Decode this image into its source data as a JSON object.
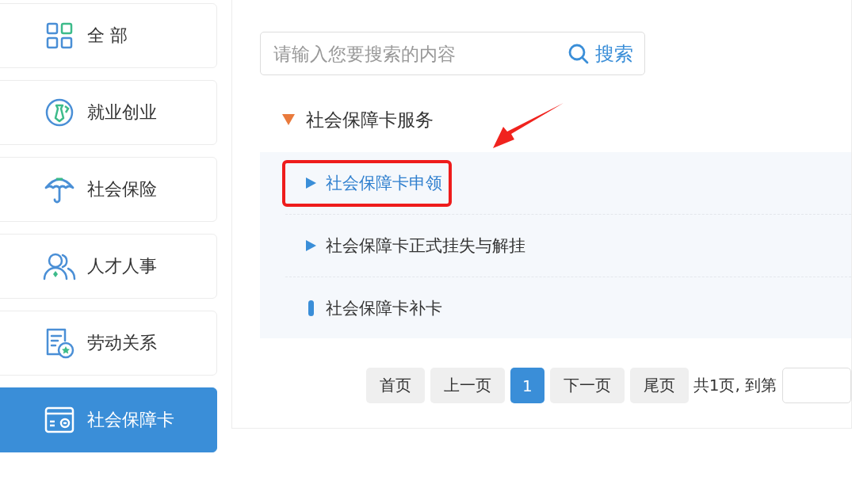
{
  "sidebar": {
    "items": [
      {
        "label": "全 部",
        "kind": "grid",
        "selected": false
      },
      {
        "label": "就业创业",
        "kind": "tie",
        "selected": false
      },
      {
        "label": "社会保险",
        "kind": "umbrella",
        "selected": false
      },
      {
        "label": "人才人事",
        "kind": "people",
        "selected": false
      },
      {
        "label": "劳动关系",
        "kind": "document",
        "selected": false
      },
      {
        "label": "社会保障卡",
        "kind": "card",
        "selected": true
      }
    ]
  },
  "search": {
    "placeholder": "请输入您要搜索的内容",
    "button": "搜索"
  },
  "tree": {
    "label": "社会保障卡服务",
    "expanded": true,
    "children": [
      {
        "label": "社会保障卡申领",
        "kind": "branch",
        "selected": true,
        "highlighted": true
      },
      {
        "label": "社会保障卡正式挂失与解挂",
        "kind": "branch",
        "selected": false,
        "highlighted": false
      },
      {
        "label": "社会保障卡补卡",
        "kind": "leaf",
        "selected": false,
        "highlighted": false
      }
    ]
  },
  "annotations": [
    {
      "kind": "arrow"
    }
  ],
  "pagination": {
    "buttons": [
      {
        "label": "首页",
        "kind": "nav",
        "selected": false
      },
      {
        "label": "上一页",
        "kind": "nav",
        "selected": false
      },
      {
        "label": "1",
        "kind": "page",
        "selected": true
      },
      {
        "label": "下一页",
        "kind": "nav",
        "selected": false
      },
      {
        "label": "尾页",
        "kind": "nav",
        "selected": false
      }
    ],
    "summary": "共1页, 到第"
  }
}
